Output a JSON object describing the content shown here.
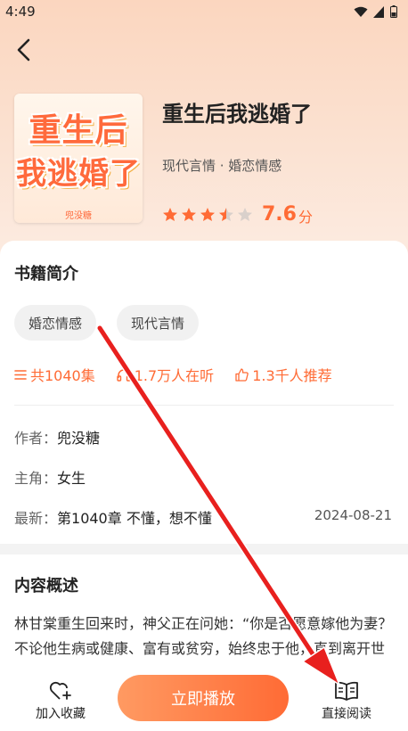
{
  "status_bar": {
    "time": "4:49"
  },
  "book": {
    "title": "重生后我逃婚了",
    "genre": "现代言情 · 婚恋情感",
    "rating": 3.5,
    "score": "7.6",
    "score_unit": "分",
    "cover": {
      "title_line1": "重生后",
      "title_line2": "我逃婚了",
      "author": "兜没糖"
    }
  },
  "intro": {
    "title": "书籍简介",
    "tags": [
      "婚恋情感",
      "现代言情"
    ],
    "episodes": "共1040集",
    "listeners": "1.7万人在听",
    "recommends": "1.3千人推荐",
    "author_label": "作者：",
    "author": "兜没糖",
    "lead_label": "主角：",
    "lead": "女生",
    "latest_label": "最新：",
    "latest": "第1040章 不懂，想不懂",
    "latest_date": "2024-08-21"
  },
  "summary": {
    "title": "内容概述",
    "text": "林甘棠重生回来时，神父正在问她：“你是否愿意嫁他为妻？不论他生病或健康、富有或贫穷，始终忠于他，直到离开世界？”"
  },
  "bottom": {
    "favorite": "加入收藏",
    "play": "立即播放",
    "read": "直接阅读"
  },
  "colors": {
    "accent": "#ff6b35",
    "arrow": "#e8201e"
  }
}
